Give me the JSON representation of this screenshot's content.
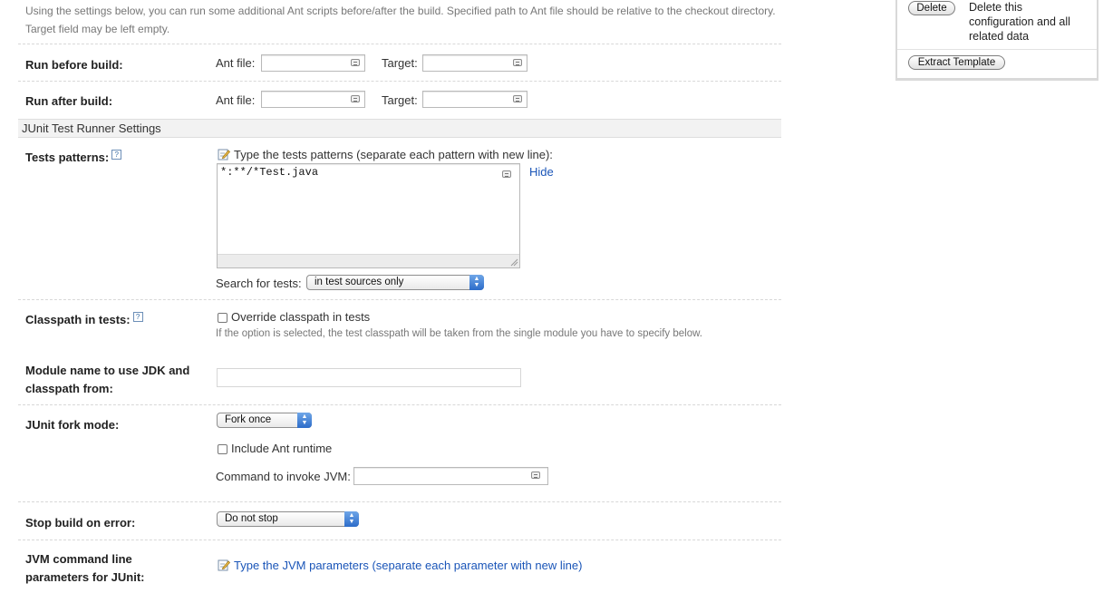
{
  "intro": "Using the settings below, you can run some additional Ant scripts before/after the build. Specified path to Ant file should be relative to the checkout directory. Target field may be left empty.",
  "run_before": {
    "label": "Run before build:",
    "ant_file_label": "Ant file:",
    "target_label": "Target:"
  },
  "run_after": {
    "label": "Run after build:",
    "ant_file_label": "Ant file:",
    "target_label": "Target:"
  },
  "junit_section": "JUnit Test Runner Settings",
  "tests_patterns": {
    "label": "Tests patterns:",
    "help": "?",
    "hint": "Type the tests patterns (separate each pattern with new line):",
    "value": "*:**/*Test.java",
    "hide_link": "Hide",
    "search_label": "Search for tests:",
    "search_value": "in test sources only"
  },
  "classpath": {
    "label": "Classpath in tests:",
    "help": "?",
    "checkbox_label": "Override classpath in tests",
    "note": "If the option is selected, the test classpath will be taken from the single module you have to specify below."
  },
  "module_name": {
    "label_line1": "Module name to use JDK and",
    "label_line2": "classpath from:",
    "value": ""
  },
  "fork_mode": {
    "label": "JUnit fork mode:",
    "value": "Fork once",
    "include_ant_label": "Include Ant runtime",
    "command_label": "Command to invoke JVM:"
  },
  "stop_build": {
    "label": "Stop build on error:",
    "value": "Do not stop"
  },
  "jvm_params": {
    "label_line1": "JVM command line",
    "label_line2": "parameters for JUnit:",
    "link": "Type the JVM parameters (separate each parameter with new line)"
  },
  "side_panel": {
    "delete_button": "Delete",
    "delete_desc_line1": "Delete this",
    "delete_desc_line2": "configuration and all",
    "delete_desc_line3": "related data",
    "extract_button": "Extract Template"
  }
}
